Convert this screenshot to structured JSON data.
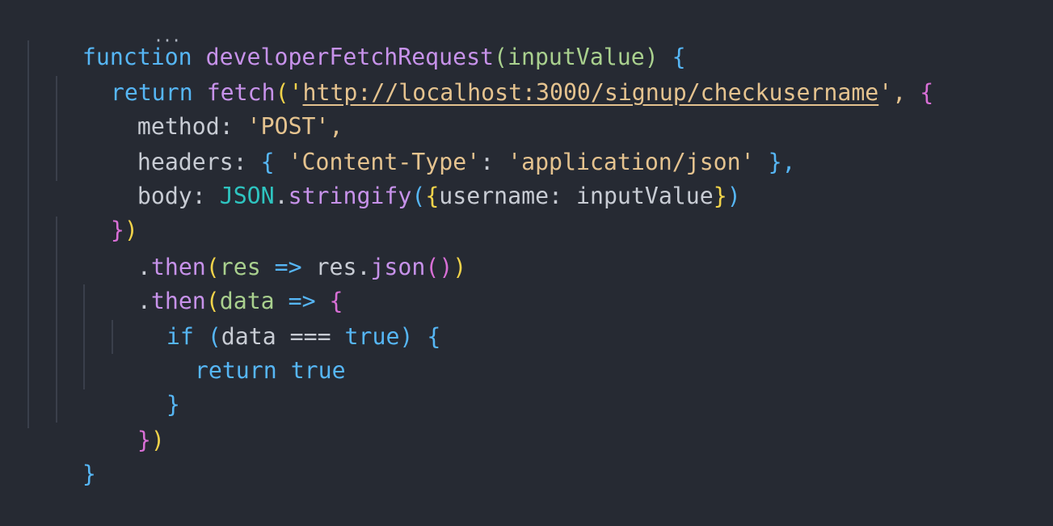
{
  "code": {
    "line1": {
      "keyword": "function",
      "name": "developerFetchRequest",
      "open_paren": "(",
      "param": "inputValue",
      "close_paren": ")",
      "space_brace": " {"
    },
    "line2": {
      "keyword": "return",
      "call": "fetch",
      "open": "('",
      "url": "http://localhost:3000/signup/checkusername",
      "close": "',",
      "brace": " {"
    },
    "line3": {
      "prop": "method:",
      "value": " 'POST',"
    },
    "line4": {
      "prop": "headers:",
      "open": " {",
      "key": " 'Content-Type'",
      "colon": ":",
      "value": " 'application/json'",
      "close": " },"
    },
    "line5": {
      "prop": "body:",
      "json": " JSON",
      "dot": ".",
      "call": "stringify",
      "open_paren": "(",
      "open_brace": "{",
      "inner": "username: inputValue",
      "close_brace": "}",
      "close_paren": ")"
    },
    "line6": {
      "close_brace": "}",
      "close_paren": ")"
    },
    "line7": {
      "dot": ".",
      "call": "then",
      "open": "(",
      "param": "res",
      "arrow": " =>",
      "body": " res.",
      "call2": "json",
      "parens": "()",
      "close": ")"
    },
    "line8": {
      "dot": ".",
      "call": "then",
      "open": "(",
      "param": "data",
      "arrow": " =>",
      "brace": " {"
    },
    "line9": {
      "keyword": "if",
      "open": " (",
      "expr": "data ===",
      "true": " true",
      "close": ")",
      "brace": " {"
    },
    "line10": {
      "keyword": "return",
      "true": " true"
    },
    "line11": {
      "brace": "}"
    },
    "line12": {
      "close_brace": "}",
      "close_paren": ")"
    },
    "line13": {
      "brace": "}"
    }
  },
  "editor": {
    "ellipsis": "···"
  },
  "colors": {
    "background": "#262a33",
    "keyword": "#56b6f5",
    "function": "#c792ea",
    "param": "#a9d08e",
    "string": "#e5c38f",
    "json": "#2ec4c0",
    "brace_yellow": "#f1d34a",
    "brace_pink": "#d86fd6"
  }
}
